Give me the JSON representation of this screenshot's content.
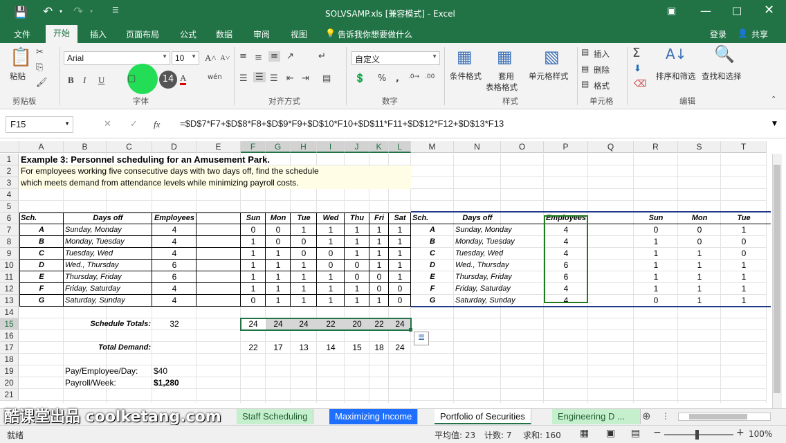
{
  "window": {
    "title": "SOLVSAMP.xls  [兼容模式] - Excel",
    "login": "登录",
    "share": "共享"
  },
  "menu": [
    "文件",
    "开始",
    "插入",
    "页面布局",
    "公式",
    "数据",
    "审阅",
    "视图"
  ],
  "tell_me": "告诉我你想要做什么",
  "ribbon": {
    "paste": "粘贴",
    "clipboard": "剪贴板",
    "font_name": "Arial",
    "font_size": "10",
    "font_group": "字体",
    "font_bubble": "14",
    "align_group": "对齐方式",
    "number_format": "自定义",
    "number_group": "数字",
    "cond_format": "条件格式",
    "table_format_1": "套用",
    "table_format_2": "表格格式",
    "cell_style": "单元格样式",
    "style_group": "样式",
    "insert": "插入",
    "delete": "删除",
    "format": "格式",
    "cells_group": "单元格",
    "sort_filter": "排序和筛选",
    "find_select": "查找和选择",
    "edit_group": "编辑"
  },
  "namebox": "F15",
  "formula": "=$D$7*F7+$D$8*F8+$D$9*F9+$D$10*F10+$D$11*F11+$D$12*F12+$D$13*F13",
  "columns": [
    "A",
    "B",
    "C",
    "D",
    "E",
    "F",
    "G",
    "H",
    "I",
    "J",
    "K",
    "L",
    "M",
    "N",
    "O",
    "P",
    "Q",
    "R",
    "S",
    "T"
  ],
  "rows": [
    "1",
    "2",
    "3",
    "4",
    "5",
    "6",
    "7",
    "8",
    "9",
    "10",
    "11",
    "12",
    "13",
    "14",
    "15",
    "16",
    "17",
    "18",
    "19",
    "20",
    "21"
  ],
  "sheet": {
    "title": "Example 3:  Personnel scheduling for an Amusement Park.",
    "desc1": "For employees working five consecutive days with two days off, find the schedule",
    "desc2": "which meets demand from attendance levels while minimizing payroll costs.",
    "h_sch": "Sch.",
    "h_days": "Days off",
    "h_emp": "Employees",
    "days": [
      "Sun",
      "Mon",
      "Tue",
      "Wed",
      "Thu",
      "Fri",
      "Sat"
    ],
    "schedules": [
      {
        "sch": "A",
        "off": "Sunday, Monday",
        "emp": "4",
        "v": [
          "0",
          "0",
          "1",
          "1",
          "1",
          "1",
          "1"
        ]
      },
      {
        "sch": "B",
        "off": "Monday, Tuesday",
        "emp": "4",
        "v": [
          "1",
          "0",
          "0",
          "1",
          "1",
          "1",
          "1"
        ]
      },
      {
        "sch": "C",
        "off": "Tuesday, Wed",
        "emp": "4",
        "v": [
          "1",
          "1",
          "0",
          "0",
          "1",
          "1",
          "1"
        ]
      },
      {
        "sch": "D",
        "off": "Wed., Thursday",
        "emp": "6",
        "v": [
          "1",
          "1",
          "1",
          "0",
          "0",
          "1",
          "1"
        ]
      },
      {
        "sch": "E",
        "off": "Thursday, Friday",
        "emp": "6",
        "v": [
          "1",
          "1",
          "1",
          "1",
          "0",
          "0",
          "1"
        ]
      },
      {
        "sch": "F",
        "off": "Friday, Saturday",
        "emp": "4",
        "v": [
          "1",
          "1",
          "1",
          "1",
          "1",
          "0",
          "0"
        ]
      },
      {
        "sch": "G",
        "off": "Saturday, Sunday",
        "emp": "4",
        "v": [
          "0",
          "1",
          "1",
          "1",
          "1",
          "1",
          "0"
        ]
      }
    ],
    "totals_label": "Schedule Totals:",
    "totals_emp": "32",
    "totals": [
      "24",
      "24",
      "24",
      "22",
      "20",
      "22",
      "24"
    ],
    "demand_label": "Total Demand:",
    "demand": [
      "22",
      "17",
      "13",
      "14",
      "15",
      "18",
      "24"
    ],
    "pay_label": "Pay/Employee/Day:",
    "pay": "$40",
    "payroll_label": "Payroll/Week:",
    "payroll": "$1,280",
    "right_days": [
      "Sun",
      "Mon",
      "Tue"
    ],
    "right_vals": [
      [
        "0",
        "0",
        "1"
      ],
      [
        "1",
        "0",
        "0"
      ],
      [
        "1",
        "1",
        "0"
      ],
      [
        "1",
        "1",
        "1"
      ],
      [
        "1",
        "1",
        "1"
      ],
      [
        "1",
        "1",
        "1"
      ],
      [
        "0",
        "1",
        "1"
      ]
    ]
  },
  "tabs": [
    "Staff Scheduling",
    "Maximizing Income",
    "Portfolio of Securities",
    "Engineering D ..."
  ],
  "status": {
    "ready": "就绪",
    "avg": "平均值: 23",
    "count": "计数: 7",
    "sum": "求和: 160",
    "zoom": "100%"
  },
  "watermark": "酷课堂出品 coolketang.com",
  "colors": {
    "excel_green": "#217346",
    "tab_green": "#c6efce",
    "tab_blue": "#1f6fff",
    "navy": "#1f3a8a",
    "sel": "#217346"
  }
}
